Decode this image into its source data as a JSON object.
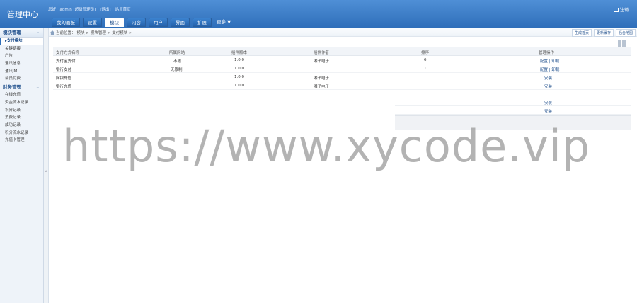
{
  "header": {
    "title": "管理中心",
    "greeting": "您好！admin [超级管理员]",
    "logout_link": "[退出]",
    "site_home": "站点首页",
    "logout_label": "注销",
    "tabs": [
      "我的面板",
      "设置",
      "模块",
      "内容",
      "用户",
      "界面",
      "扩展"
    ],
    "active_tab": "模块",
    "more_label": "更多"
  },
  "sidebar": {
    "section1": "模块管理",
    "items1": [
      "支付模块",
      "关键链接",
      "广告",
      "通讯信息",
      "通讯IM",
      "会员付费"
    ],
    "active_item": "支付模块",
    "section2": "财务管理",
    "items2": [
      "在线充值",
      "资金流水记录",
      "积分记录",
      "消费记录",
      "成功记录",
      "积分流水记录",
      "充值卡管理"
    ]
  },
  "content": {
    "breadcrumb": [
      "当前位置：",
      "模块 >",
      "模块管理 >",
      "支付模块 >"
    ],
    "quick_links": [
      "生成首页",
      "更新缓存",
      "后台地图"
    ],
    "columns": [
      "支付方式名称",
      "所属网站",
      "插件版本",
      "插件作者",
      "排序",
      "管理操作"
    ],
    "rows": [
      {
        "name": "支付宝支付",
        "site": "不限",
        "version": "1.0.0",
        "author": "湘子电子",
        "order": "6",
        "ops": "配置 | 卸载"
      },
      {
        "name": "银行支付",
        "site": "无限制",
        "version": "1.0.0",
        "author": "",
        "order": "1",
        "ops": "配置 | 卸载"
      },
      {
        "name": "网银充值",
        "site": "",
        "version": "1.0.0",
        "author": "湘子电子",
        "order": "",
        "ops": "安装"
      },
      {
        "name": "银行充值",
        "site": "",
        "version": "1.0.0",
        "author": "湘子电子",
        "order": "",
        "ops": "安装"
      }
    ],
    "extra_ops": [
      "安装",
      "安装"
    ]
  },
  "watermark": "https://www.xycode.vip"
}
